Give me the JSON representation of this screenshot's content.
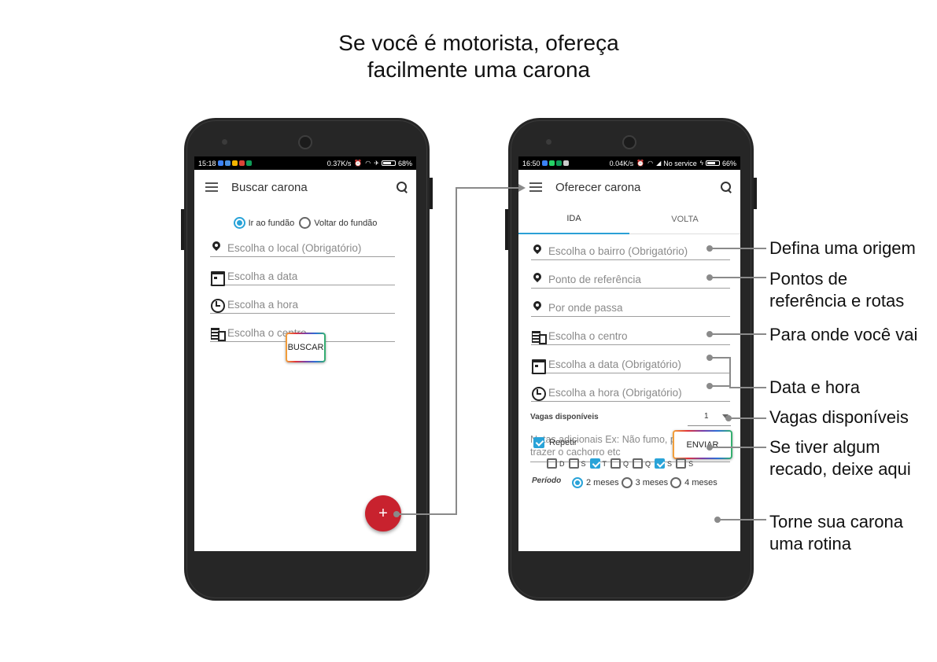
{
  "headline": {
    "line1": "Se você é motorista, ofereça",
    "line2": "facilmente uma carona"
  },
  "left_phone": {
    "status": {
      "time": "15:18",
      "speed": "0.37K/s",
      "battery": "68%"
    },
    "appbar": {
      "title": "Buscar carona"
    },
    "radio": {
      "option1": "Ir ao fundão",
      "option2": "Voltar do fundão",
      "selected": "Ir ao fundão"
    },
    "fields": {
      "local": "Escolha o local (Obrigatório)",
      "data": "Escolha a data",
      "hora": "Escolha a hora",
      "centro": "Escolha o centro"
    },
    "buscar_label": "BUSCAR",
    "fab_label": "+"
  },
  "right_phone": {
    "status": {
      "time": "16:50",
      "speed": "0.04K/s",
      "network": "No service",
      "battery": "66%"
    },
    "appbar": {
      "title": "Oferecer carona"
    },
    "tabs": {
      "ida": "IDA",
      "volta": "VOLTA",
      "active": "IDA"
    },
    "fields": {
      "bairro": "Escolha o bairro (Obrigatório)",
      "referencia": "Ponto de referência",
      "passa": "Por onde passa",
      "centro": "Escolha o centro",
      "data": "Escolha a data (Obrigatório)",
      "hora": "Escolha a hora (Obrigatório)"
    },
    "vagas": {
      "label": "Vagas disponíveis",
      "value": "1"
    },
    "notes": {
      "line1": "Notas adicionais Ex: Não fumo, pode",
      "line2": "trazer o cachorro etc"
    },
    "enviar_label": "ENVIAR",
    "repetir": {
      "label": "Repetir",
      "checked": true
    },
    "days": [
      {
        "label": "D",
        "checked": false
      },
      {
        "label": "S",
        "checked": false
      },
      {
        "label": "T",
        "checked": true
      },
      {
        "label": "Q",
        "checked": false
      },
      {
        "label": "Q",
        "checked": false
      },
      {
        "label": "S",
        "checked": true
      },
      {
        "label": "S",
        "checked": false
      }
    ],
    "periodo": {
      "label": "Período",
      "options": [
        "2 meses",
        "3 meses",
        "4 meses"
      ],
      "selected": "2 meses"
    }
  },
  "callouts": {
    "origem": "Defina uma origem",
    "pontos1": "Pontos de",
    "pontos2": "referência e rotas",
    "destino": "Para onde você vai",
    "datahora": "Data e hora",
    "vagas": "Vagas disponíveis",
    "recado1": "Se tiver algum",
    "recado2": "recado, deixe aqui",
    "rotina1": "Torne sua carona",
    "rotina2": "uma rotina"
  },
  "colors": {
    "accent": "#29a3d8",
    "fab": "#c8222e",
    "phone_body": "#262626"
  }
}
